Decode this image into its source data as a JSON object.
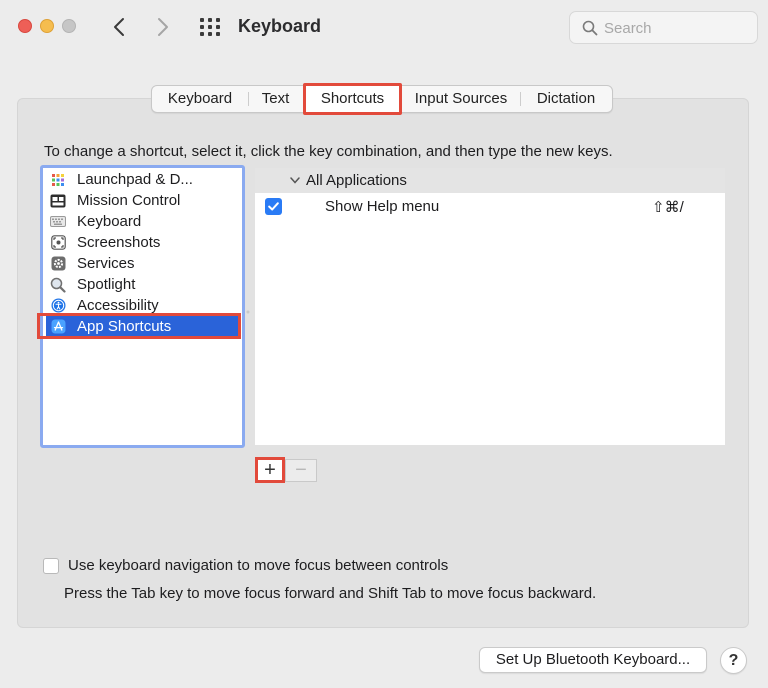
{
  "window": {
    "title": "Keyboard",
    "search_placeholder": "Search"
  },
  "tabs": [
    {
      "label": "Keyboard",
      "selected": false
    },
    {
      "label": "Text",
      "selected": false
    },
    {
      "label": "Shortcuts",
      "selected": true
    },
    {
      "label": "Input Sources",
      "selected": false
    },
    {
      "label": "Dictation",
      "selected": false
    }
  ],
  "instruction": "To change a shortcut, select it, click the key combination, and then type the new keys.",
  "categories": [
    {
      "label": "Launchpad & D...",
      "icon": "launchpad-icon"
    },
    {
      "label": "Mission Control",
      "icon": "mission-control-icon"
    },
    {
      "label": "Keyboard",
      "icon": "keyboard-icon"
    },
    {
      "label": "Screenshots",
      "icon": "screenshots-icon"
    },
    {
      "label": "Services",
      "icon": "services-gear-icon"
    },
    {
      "label": "Spotlight",
      "icon": "spotlight-magnifier-icon"
    },
    {
      "label": "Accessibility",
      "icon": "accessibility-icon"
    },
    {
      "label": "App Shortcuts",
      "icon": "app-store-icon",
      "selected": true
    }
  ],
  "shortcuts": {
    "group_label": "All Applications",
    "rows": [
      {
        "name": "Show Help menu",
        "keys": "⇧⌘/",
        "checked": true
      }
    ]
  },
  "buttons": {
    "add": "+",
    "remove": "−",
    "bluetooth": "Set Up Bluetooth Keyboard...",
    "help": "?"
  },
  "kbnav": {
    "label": "Use keyboard navigation to move focus between controls",
    "help": "Press the Tab key to move focus forward and Shift Tab to move focus backward.",
    "checked": false
  },
  "colors": {
    "highlight_outline": "#e24a3b",
    "selection_blue": "#2a63d9",
    "focus_ring": "#8aaaf0",
    "checkbox_blue": "#2a7bf5"
  }
}
